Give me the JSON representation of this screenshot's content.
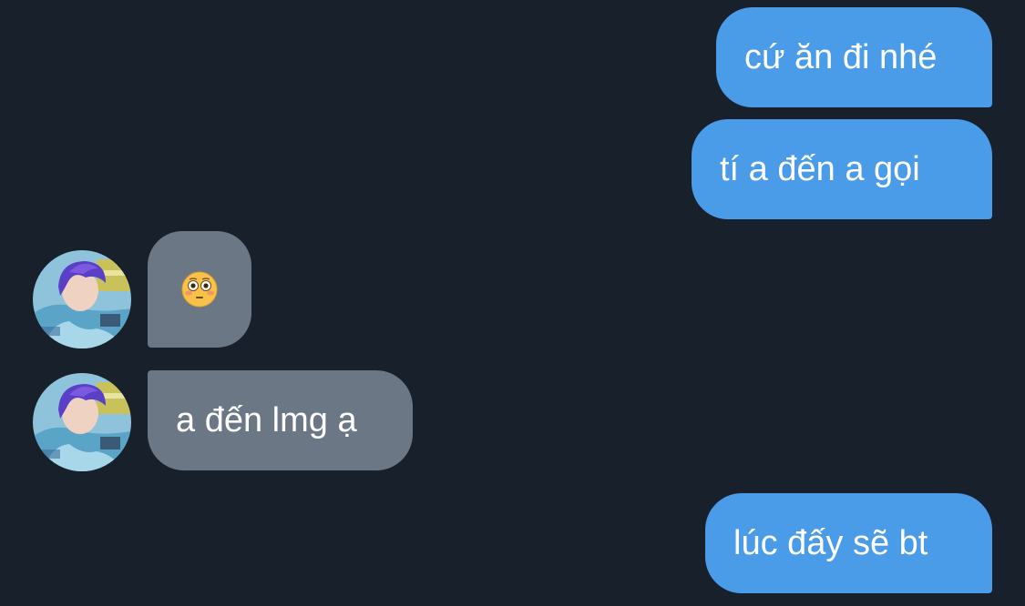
{
  "messages": [
    {
      "side": "outgoing",
      "text": "cứ ăn đi nhé"
    },
    {
      "side": "outgoing",
      "text": "tí a đến a gọi"
    },
    {
      "side": "incoming",
      "emoji": "flushed-face-emoji"
    },
    {
      "side": "incoming",
      "text": "a đến lmg ạ"
    },
    {
      "side": "outgoing",
      "text": "lúc đấy sẽ bt"
    }
  ],
  "colors": {
    "background": "#18202b",
    "outgoing_bubble": "#4a9be8",
    "incoming_bubble": "#6b7785",
    "text": "#ffffff"
  }
}
